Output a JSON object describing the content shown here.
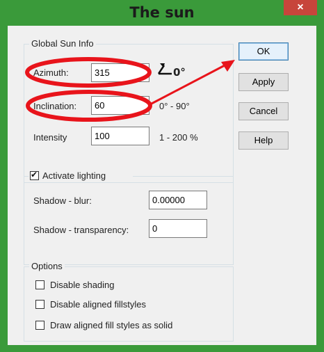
{
  "window": {
    "title": "The sun",
    "close_glyph": "×"
  },
  "global_sun_info": {
    "legend": "Global Sun Info",
    "azimuth_label": "Azimuth:",
    "azimuth_value": "315",
    "azimuth_indicator": "0°",
    "inclination_label": "Inclination:",
    "inclination_value": "60",
    "inclination_range": "0° - 90°",
    "intensity_label": "Intensity",
    "intensity_value": "100",
    "intensity_range": "1 - 200 %"
  },
  "lighting": {
    "activate_label": "Activate lighting",
    "activate_checked": true,
    "shadow_blur_label": "Shadow - blur:",
    "shadow_blur_value": "0.00000",
    "shadow_transparency_label": "Shadow - transparency:",
    "shadow_transparency_value": "0"
  },
  "options": {
    "legend": "Options",
    "items": [
      {
        "label": "Disable shading",
        "checked": false
      },
      {
        "label": "Disable aligned fillstyles",
        "checked": false
      },
      {
        "label": "Draw aligned fill styles as solid",
        "checked": false
      }
    ]
  },
  "buttons": {
    "ok": "OK",
    "apply": "Apply",
    "cancel": "Cancel",
    "help": "Help"
  },
  "annotation_color": "#e8141b"
}
